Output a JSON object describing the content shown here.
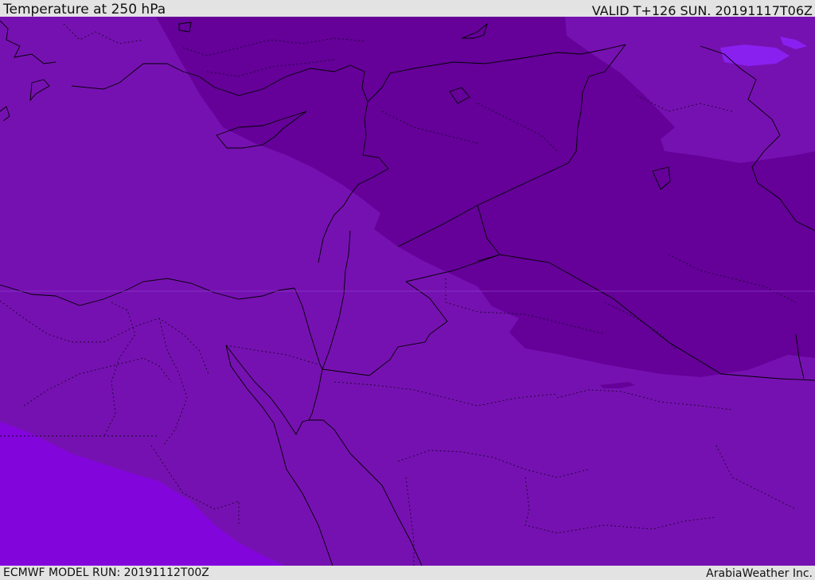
{
  "header": {
    "title": "Temperature at 250 hPa",
    "valid_time": "VALID T+126 SUN. 20191117T06Z"
  },
  "footer": {
    "model_run": "ECMWF MODEL RUN: 20191112T00Z",
    "credit": "ArabiaWeather Inc."
  },
  "colors": {
    "background_bar": "#e3e3e3",
    "band_cold": "#650099",
    "band_mid": "#7611b1",
    "band_warm": "#8205dc",
    "band_light": "#8a20f0",
    "border_line": "#000000"
  }
}
